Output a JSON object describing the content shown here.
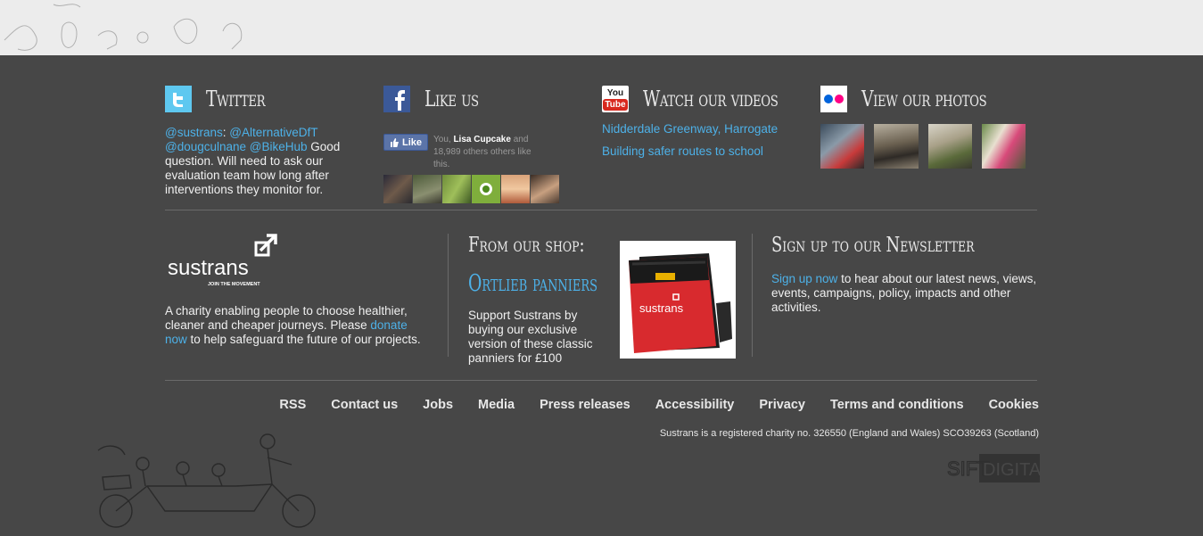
{
  "twitter": {
    "icon": "twitter-icon",
    "title": "Twitter",
    "handle": "@sustrans",
    "colon": ": ",
    "mention1": "@AlternativeDfT",
    "mention2": "@dougculnane",
    "mention3": "@BikeHub",
    "message": " Good question. Will need to ask our evaluation team how long after interventions they monitor for."
  },
  "facebook": {
    "icon": "facebook-icon",
    "title": "Like us",
    "like_button": "Like",
    "like_prefix": "You, ",
    "like_name": "Lisa Cupcake",
    "like_suffix": " and 18,989 others others like this."
  },
  "videos": {
    "icon": "youtube-icon",
    "title": "Watch our videos",
    "yt_top": "You",
    "yt_bottom": "Tube",
    "links": [
      "Nidderdale Greenway, Harrogate",
      "Building safer routes to school"
    ]
  },
  "photos": {
    "icon": "flickr-icon",
    "title": "View our photos"
  },
  "charity": {
    "logo_word": "sustrans",
    "logo_tagline": "JOIN THE MOVEMENT",
    "text_before": "A charity enabling people to choose healthier, cleaner and cheaper journeys. Please ",
    "link": "donate now",
    "text_after": " to help safeguard the future of our projects."
  },
  "shop": {
    "heading": "From our shop:",
    "product": "Ortlieb panniers",
    "description": "Support Sustrans by buying our exclusive version of these classic panniers for £100",
    "bag_brand": "sustrans"
  },
  "newsletter": {
    "heading": "Sign up to our Newsletter",
    "link": "Sign up now",
    "text": " to hear about our latest news, views, events, campaigns, policy, impacts and other activities."
  },
  "nav": [
    "RSS",
    "Contact us",
    "Jobs",
    "Media",
    "Press releases",
    "Accessibility",
    "Privacy",
    "Terms and conditions",
    "Cookies"
  ],
  "legal": "Sustrans is a registered charity no. 326550 (England and Wales) SCO39263 (Scotland)",
  "credit": {
    "left": "SIFT",
    "right": "DIGITAL"
  },
  "colors": {
    "footer_bg": "#474747",
    "link": "#4db1e8",
    "facebook": "#3b5998",
    "youtube_red": "#d8281e",
    "flickr_blue": "#0063dc",
    "flickr_pink": "#ff0084"
  }
}
